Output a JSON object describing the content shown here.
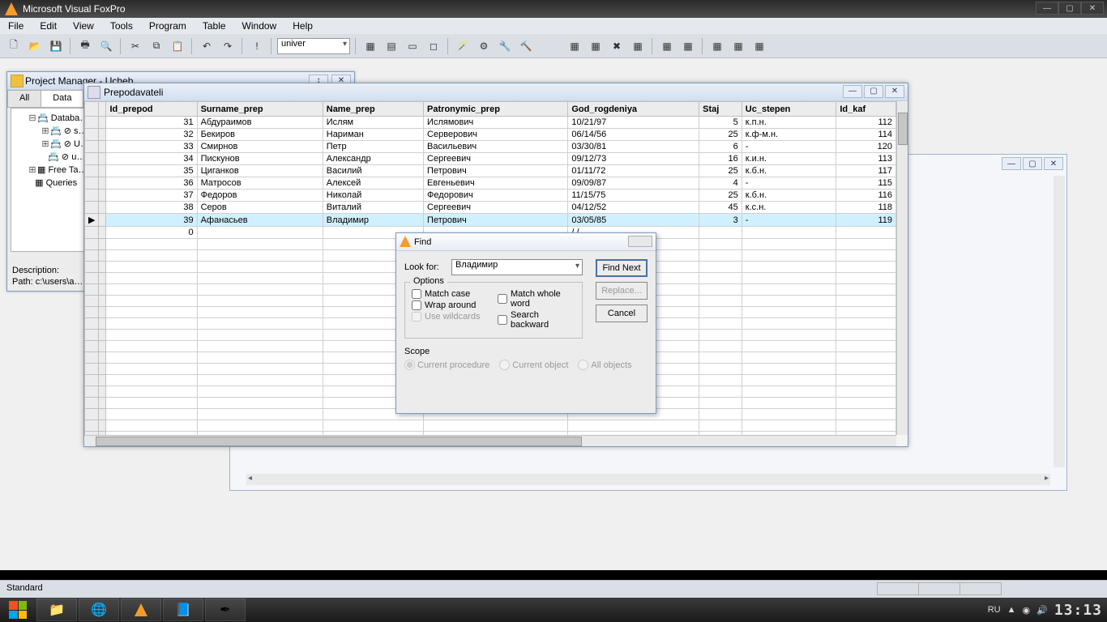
{
  "app": {
    "title": "Microsoft Visual FoxPro"
  },
  "menu": {
    "items": [
      "File",
      "Edit",
      "View",
      "Tools",
      "Program",
      "Table",
      "Window",
      "Help"
    ]
  },
  "toolbar": {
    "combo_value": "univer"
  },
  "project_manager": {
    "title": "Project Manager - Ucheb…",
    "tabs": [
      "All",
      "Data"
    ],
    "active_tab": 1,
    "tree": {
      "root": "Databa…",
      "children": [
        "⊘ s…",
        "⊘ U…",
        "⊘ u…"
      ],
      "siblings": [
        "Free Ta…",
        "Queries"
      ]
    },
    "description_label": "Description:",
    "path_label": "Path:",
    "path_value": "c:\\users\\a…"
  },
  "browse": {
    "title": "Prepodavateli",
    "columns": [
      "Id_prepod",
      "Surname_prep",
      "Name_prep",
      "Patronymic_prep",
      "God_rogdeniya",
      "Staj",
      "Uc_stepen",
      "Id_kaf"
    ],
    "rows": [
      {
        "id": "31",
        "surname": "Абдураимов",
        "name": "Ислям",
        "patr": "Ислямович",
        "god": "10/21/97",
        "staj": "5",
        "uc": "к.п.н.",
        "kaf": "112"
      },
      {
        "id": "32",
        "surname": "Бекиров",
        "name": "Нариман",
        "patr": "Серверович",
        "god": "06/14/56",
        "staj": "25",
        "uc": "к.ф-м.н.",
        "kaf": "114"
      },
      {
        "id": "33",
        "surname": "Смирнов",
        "name": "Петр",
        "patr": "Васильевич",
        "god": "03/30/81",
        "staj": "6",
        "uc": "-",
        "kaf": "120"
      },
      {
        "id": "34",
        "surname": "Пискунов",
        "name": "Александр",
        "patr": "Сергеевич",
        "god": "09/12/73",
        "staj": "16",
        "uc": "к.и.н.",
        "kaf": "113"
      },
      {
        "id": "35",
        "surname": "Циганков",
        "name": "Василий",
        "patr": "Петрович",
        "god": "01/11/72",
        "staj": "25",
        "uc": "к.б.н.",
        "kaf": "117"
      },
      {
        "id": "36",
        "surname": "Матросов",
        "name": "Алексей",
        "patr": "Евгеньевич",
        "god": "09/09/87",
        "staj": "4",
        "uc": "-",
        "kaf": "115"
      },
      {
        "id": "37",
        "surname": "Федоров",
        "name": "Николай",
        "patr": "Федорович",
        "god": "11/15/75",
        "staj": "25",
        "uc": "к.б.н.",
        "kaf": "116"
      },
      {
        "id": "38",
        "surname": "Серов",
        "name": "Виталий",
        "patr": "Сергеевич",
        "god": "04/12/52",
        "staj": "45",
        "uc": "к.с.н.",
        "kaf": "118"
      },
      {
        "id": "39",
        "surname": "Афанасьев",
        "name": "Владимир",
        "patr": "Петрович",
        "god": "03/05/85",
        "staj": "3",
        "uc": "-",
        "kaf": "119"
      }
    ],
    "blank_row": {
      "id": "0",
      "god": "/  /"
    },
    "highlight_index": 8
  },
  "find": {
    "title": "Find",
    "look_for_label": "Look for:",
    "look_for_value": "Владимир",
    "options_label": "Options",
    "match_case": "Match case",
    "match_whole": "Match whole word",
    "wrap_around": "Wrap around",
    "search_backward": "Search backward",
    "use_wildcards": "Use wildcards",
    "scope_label": "Scope",
    "scope_current_proc": "Current procedure",
    "scope_current_obj": "Current object",
    "scope_all": "All objects",
    "btn_find_next": "Find Next",
    "btn_replace": "Replace...",
    "btn_cancel": "Cancel"
  },
  "status": {
    "text": "Standard"
  },
  "tray": {
    "lang": "RU",
    "time": "13:13"
  }
}
